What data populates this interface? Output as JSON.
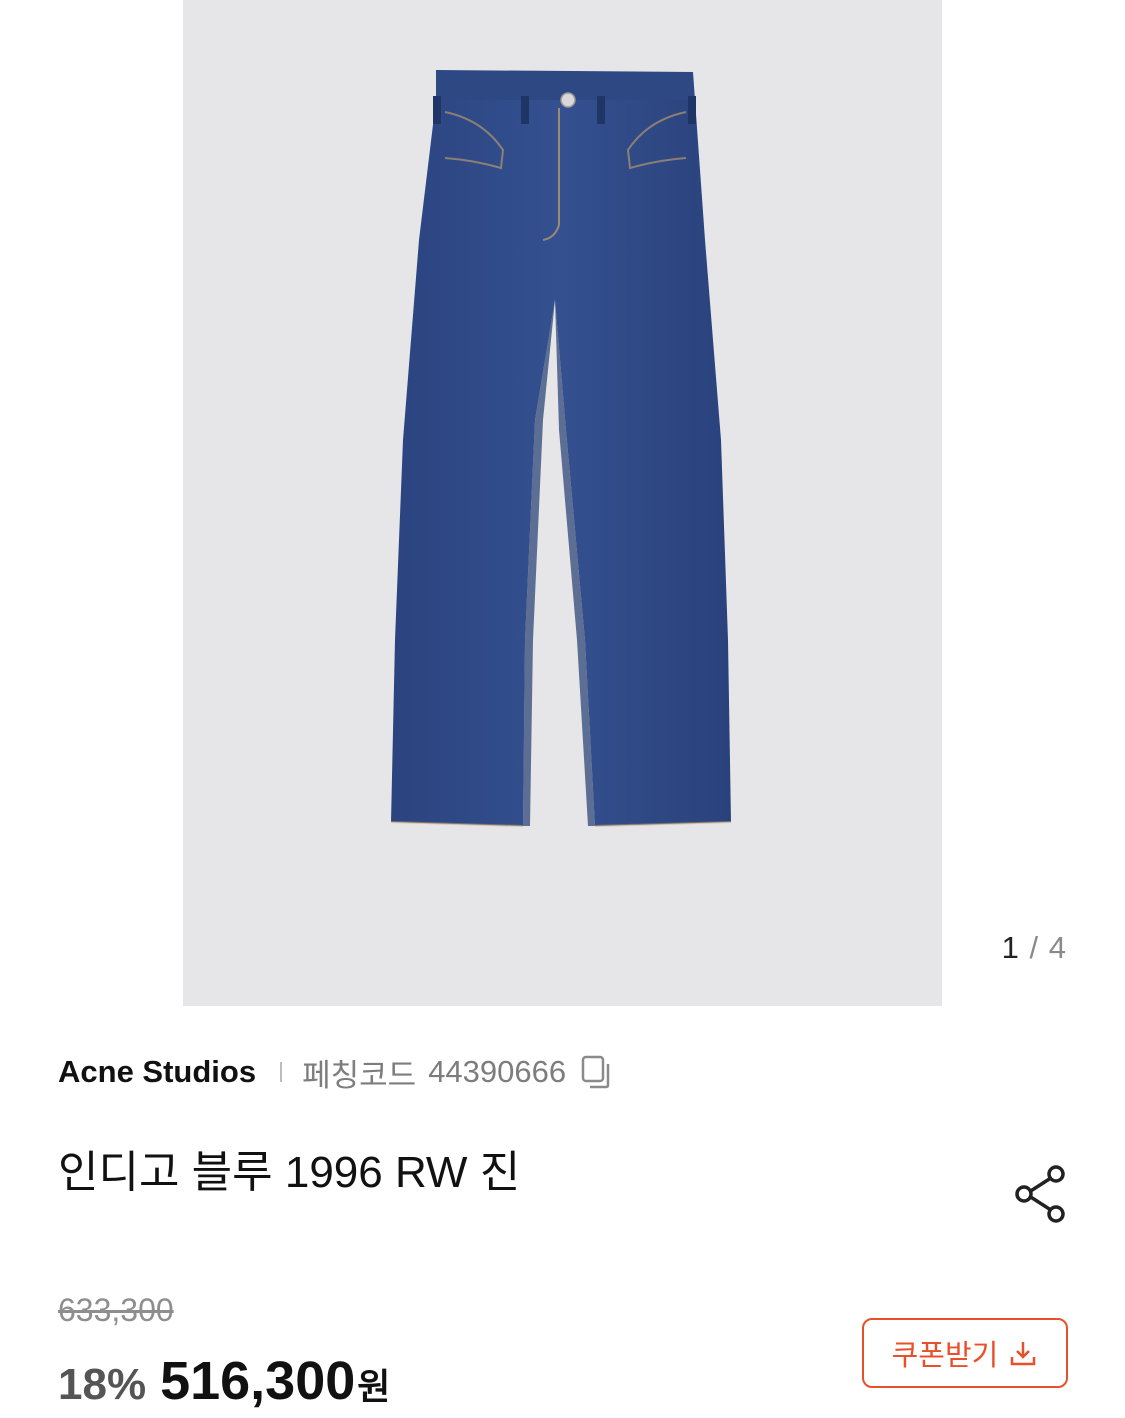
{
  "gallery": {
    "image_alt": "인디고 블루 1996 RW 진",
    "current": "1",
    "separator": "/",
    "total": "4"
  },
  "product": {
    "brand": "Acne Studios",
    "code_label": "페칭코드",
    "code_value": "44390666",
    "title": "인디고 블루 1996 RW 진"
  },
  "pricing": {
    "original_price": "633,300",
    "discount": "18%",
    "sale_price": "516,300",
    "currency": "원"
  },
  "actions": {
    "coupon_label": "쿠폰받기",
    "copy_icon": "copy-icon",
    "share_icon": "share-icon",
    "download_icon": "download-icon"
  },
  "colors": {
    "accent": "#e8502a",
    "image_background": "#e6e6e8",
    "denim": "#2f4a86"
  }
}
